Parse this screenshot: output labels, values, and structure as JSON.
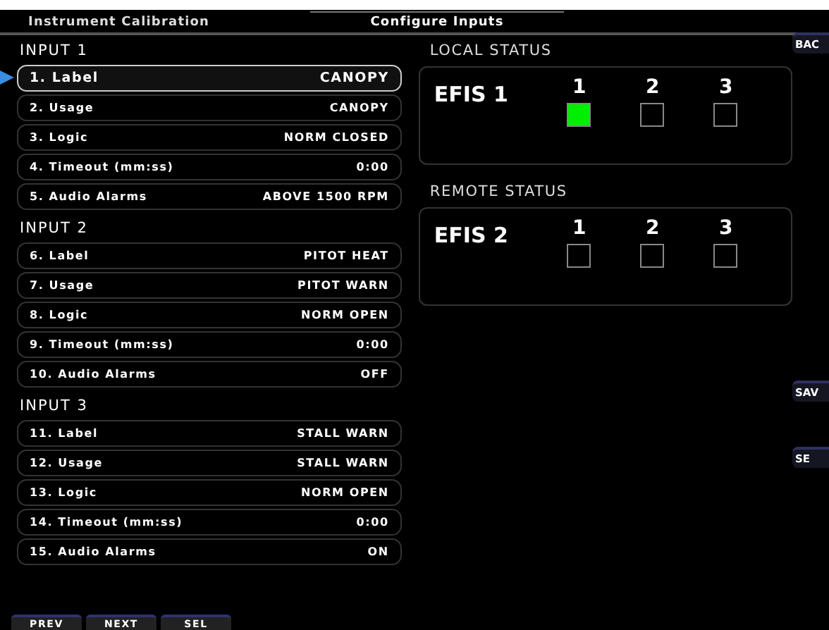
{
  "tabs": [
    {
      "label": "Instrument Calibration",
      "selected": false
    },
    {
      "label": "Configure Inputs",
      "selected": true
    }
  ],
  "inputs": [
    {
      "title": "INPUT 1",
      "rows": [
        {
          "label": "1. Label",
          "value": "CANOPY",
          "selected": true
        },
        {
          "label": "2. Usage",
          "value": "CANOPY",
          "selected": false
        },
        {
          "label": "3. Logic",
          "value": "NORM CLOSED",
          "selected": false
        },
        {
          "label": "4. Timeout  (mm:ss)",
          "value": "0:00",
          "selected": false
        },
        {
          "label": "5. Audio Alarms",
          "value": "ABOVE 1500 RPM",
          "selected": false
        }
      ]
    },
    {
      "title": "INPUT 2",
      "rows": [
        {
          "label": "6. Label",
          "value": "PITOT HEAT",
          "selected": false
        },
        {
          "label": "7. Usage",
          "value": "PITOT WARN",
          "selected": false
        },
        {
          "label": "8. Logic",
          "value": "NORM OPEN",
          "selected": false
        },
        {
          "label": "9. Timeout  (mm:ss)",
          "value": "0:00",
          "selected": false
        },
        {
          "label": "10. Audio Alarms",
          "value": "OFF",
          "selected": false
        }
      ]
    },
    {
      "title": "INPUT 3",
      "rows": [
        {
          "label": "11. Label",
          "value": "STALL WARN",
          "selected": false
        },
        {
          "label": "12. Usage",
          "value": "STALL WARN",
          "selected": false
        },
        {
          "label": "13. Logic",
          "value": "NORM OPEN",
          "selected": false
        },
        {
          "label": "14. Timeout  (mm:ss)",
          "value": "0:00",
          "selected": false
        },
        {
          "label": "15. Audio Alarms",
          "value": "ON",
          "selected": false
        }
      ]
    }
  ],
  "status": [
    {
      "title": "LOCAL STATUS",
      "efis": "EFIS 1",
      "channels": [
        {
          "number": "1",
          "on": true
        },
        {
          "number": "2",
          "on": false
        },
        {
          "number": "3",
          "on": false
        }
      ]
    },
    {
      "title": "REMOTE STATUS",
      "efis": "EFIS 2",
      "channels": [
        {
          "number": "1",
          "on": false
        },
        {
          "number": "2",
          "on": false
        },
        {
          "number": "3",
          "on": false
        }
      ]
    }
  ],
  "side_buttons": [
    "BAC",
    "SAV",
    "SE"
  ],
  "softkeys": [
    "PREV",
    "NEXT",
    "SEL"
  ]
}
